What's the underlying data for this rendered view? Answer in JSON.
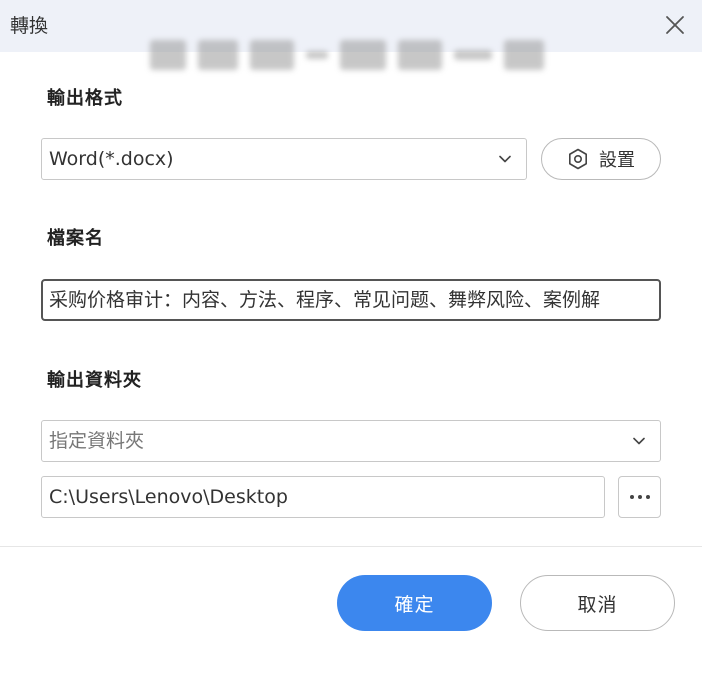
{
  "dialog": {
    "title": "轉換"
  },
  "output_format": {
    "label": "輸出格式",
    "selected": "Word(*.docx)",
    "settings_label": "設置"
  },
  "file_name": {
    "label": "檔案名",
    "value": "采购价格审计：内容、方法、程序、常见问题、舞弊风险、案例解"
  },
  "output_folder": {
    "label": "輸出資料夾",
    "mode_selected": "指定資料夾",
    "path": "C:\\Users\\Lenovo\\Desktop"
  },
  "footer": {
    "confirm_label": "確定",
    "cancel_label": "取消"
  },
  "colors": {
    "primary": "#3c87ee",
    "titlebar_bg": "#eef1f8"
  },
  "icons": {
    "close": "close-icon",
    "settings": "hexagon-gear-icon",
    "dropdown": "chevron-down-icon",
    "browse": "more-horizontal-icon"
  }
}
